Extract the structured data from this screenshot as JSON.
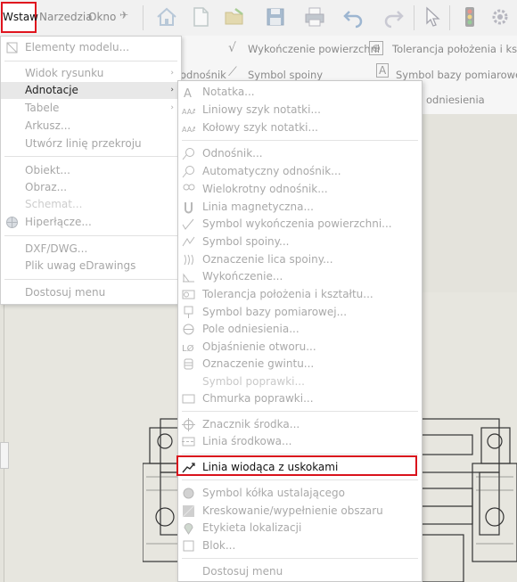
{
  "menubar": {
    "wstaw": "Wstaw",
    "narzedzia": "Narzedzia",
    "okno": "Okno",
    "pin": "✈"
  },
  "ribbon": {
    "wykonczenie": "Wykończenie powierzchni",
    "tolerancja": "Tolerancja położenia i kształt",
    "odnosnik": "odnośnik",
    "symbol_spoiny": "Symbol spoiny",
    "symbol_bazy": "Symbol bazy pomiarowej",
    "odniesienia": "odniesienia"
  },
  "main_menu": {
    "items": [
      {
        "label": "Elementy modelu...",
        "enabled": false
      },
      {
        "label": "Widok rysunku",
        "enabled": false,
        "arrow": true
      },
      {
        "label": "Adnotacje",
        "enabled": true,
        "arrow": true,
        "hover": true
      },
      {
        "label": "Tabele",
        "enabled": false,
        "arrow": true
      },
      {
        "label": "Arkusz...",
        "enabled": false
      },
      {
        "label": "Utwórz linię przekroju",
        "enabled": false
      },
      {
        "label": "Obiekt...",
        "enabled": false
      },
      {
        "label": "Obraz...",
        "enabled": false
      },
      {
        "label": "Schemat...",
        "enabled": false
      },
      {
        "label": "Hiperłącze...",
        "enabled": false
      },
      {
        "label": "DXF/DWG...",
        "enabled": false
      },
      {
        "label": "Plik uwag eDrawings",
        "enabled": false
      },
      {
        "label": "Dostosuj menu",
        "enabled": false
      }
    ]
  },
  "submenu": {
    "items": [
      {
        "label": "Notatka..."
      },
      {
        "label": "Liniowy szyk notatki..."
      },
      {
        "label": "Kołowy szyk notatki..."
      },
      {
        "label": "Odnośnik..."
      },
      {
        "label": "Automatyczny odnośnik..."
      },
      {
        "label": "Wielokrotny odnośnik..."
      },
      {
        "label": "Linia magnetyczna..."
      },
      {
        "label": "Symbol wykończenia powierzchni..."
      },
      {
        "label": "Symbol spoiny..."
      },
      {
        "label": "Oznaczenie lica spoiny..."
      },
      {
        "label": "Wykończenie..."
      },
      {
        "label": "Tolerancja położenia i kształtu..."
      },
      {
        "label": "Symbol bazy pomiarowej..."
      },
      {
        "label": "Pole odniesienia..."
      },
      {
        "label": "Objaśnienie otworu..."
      },
      {
        "label": "Oznaczenie gwintu..."
      },
      {
        "label": "Symbol poprawki..."
      },
      {
        "label": "Chmurka poprawki..."
      },
      {
        "label": "Znacznik środka..."
      },
      {
        "label": "Linia środkowa..."
      },
      {
        "label": "Linia wiodąca z uskokami"
      },
      {
        "label": "Symbol kółka ustalającego"
      },
      {
        "label": "Kreskowanie/wypełnienie obszaru"
      },
      {
        "label": "Etykieta lokalizacji"
      },
      {
        "label": "Blok..."
      },
      {
        "label": "Dostosuj menu"
      }
    ]
  }
}
